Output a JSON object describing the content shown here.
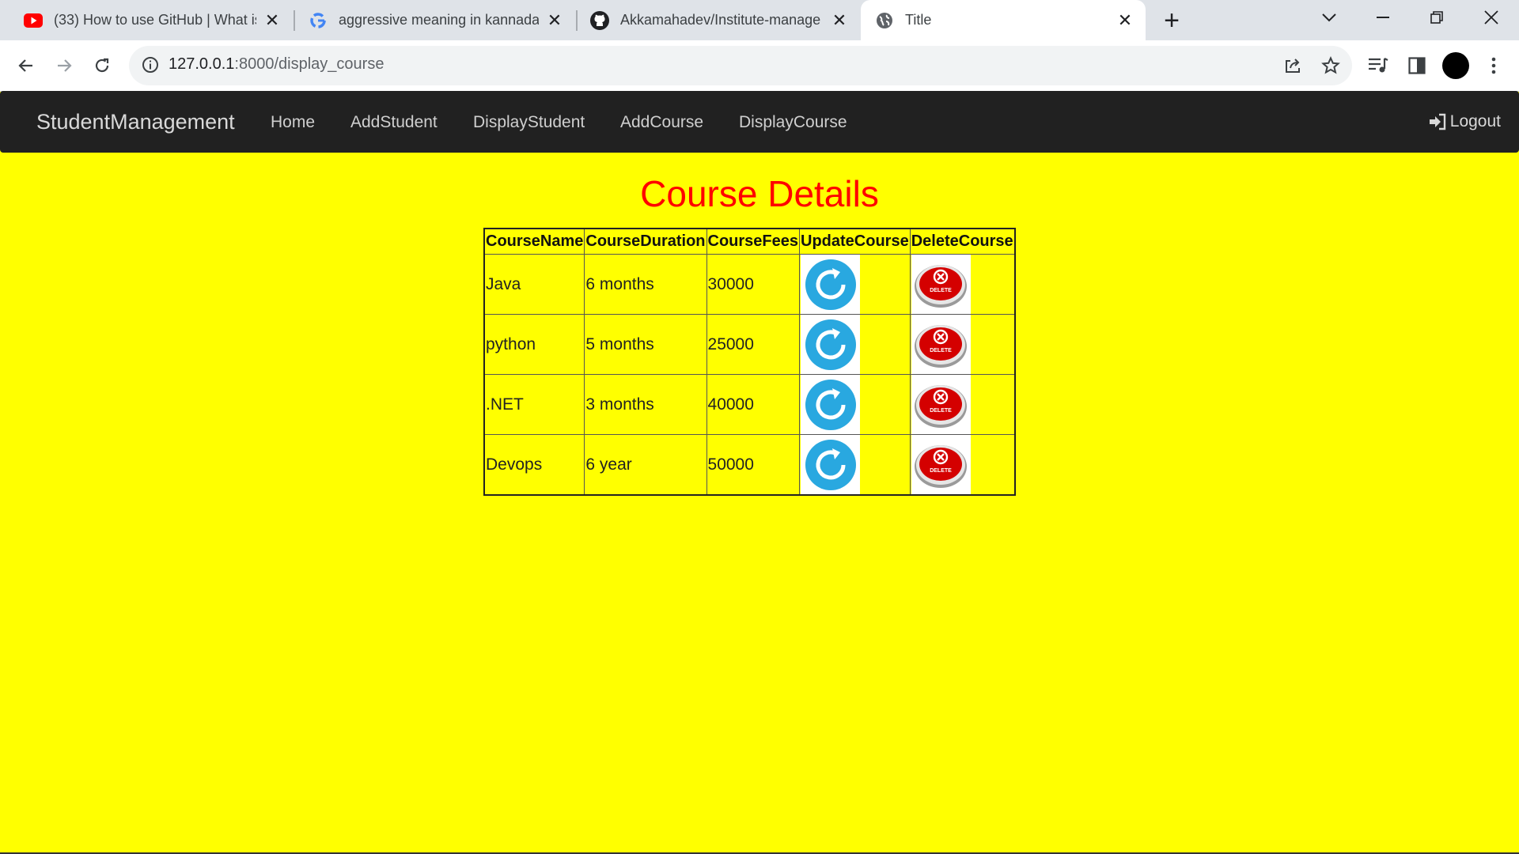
{
  "browser": {
    "tabs": [
      {
        "title": "(33) How to use GitHub | What is",
        "icon": "youtube-icon",
        "active": false
      },
      {
        "title": "aggressive meaning in kannada",
        "icon": "google-icon",
        "active": false
      },
      {
        "title": "Akkamahadev/Institute-manage",
        "icon": "github-icon",
        "active": false
      },
      {
        "title": "Title",
        "icon": "globe-icon",
        "active": true
      }
    ],
    "address": {
      "host": "127.0.0.1",
      "path": ":8000/display_course"
    }
  },
  "navbar": {
    "brand": "StudentManagement",
    "links": [
      "Home",
      "AddStudent",
      "DisplayStudent",
      "AddCourse",
      "DisplayCourse"
    ],
    "logout": "Logout"
  },
  "page": {
    "title": "Course Details",
    "table": {
      "headers": [
        "CourseName",
        "CourseDuration",
        "CourseFees",
        "UpdateCourse",
        "DeleteCourse"
      ],
      "rows": [
        {
          "name": "Java",
          "duration": "6 months",
          "fees": "30000"
        },
        {
          "name": "python",
          "duration": "5 months",
          "fees": "25000"
        },
        {
          "name": ".NET",
          "duration": "3 months",
          "fees": "40000"
        },
        {
          "name": "Devops",
          "duration": "6 year",
          "fees": "50000"
        }
      ],
      "delete_badge_text": "DELETE"
    }
  },
  "colors": {
    "page_bg": "#ffff00",
    "title": "#ff0000",
    "navbar_bg": "#212121",
    "update_icon": "#29a8e0",
    "delete_icon": "#d40000"
  }
}
